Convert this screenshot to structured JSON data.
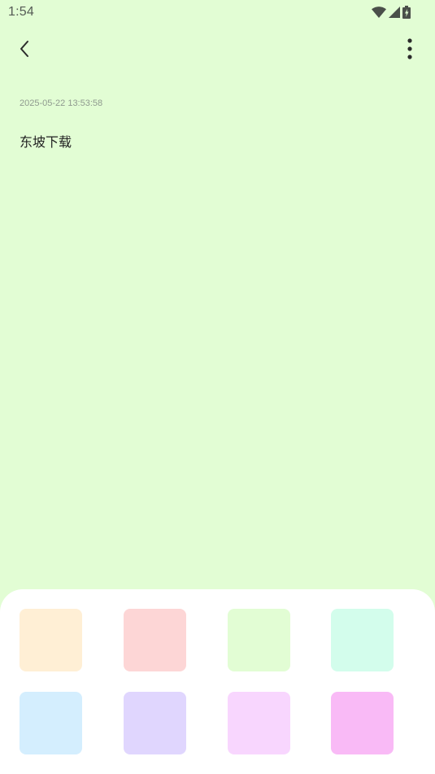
{
  "status_bar": {
    "time": "1:54",
    "icons": [
      "wifi-icon",
      "cellular-signal-icon",
      "battery-charging-icon"
    ]
  },
  "app_bar": {
    "back_icon": "chevron-left-icon",
    "more_icon": "more-vertical-icon"
  },
  "note": {
    "timestamp": "2025-05-22 13:53:58",
    "body": "东坡下载",
    "background_color": "#E2FDD4"
  },
  "color_picker": {
    "swatches": [
      {
        "name": "swatch-peach",
        "color": "#FFEFD5"
      },
      {
        "name": "swatch-pink",
        "color": "#FDD6D6"
      },
      {
        "name": "swatch-light-green",
        "color": "#E2FDD4"
      },
      {
        "name": "swatch-mint",
        "color": "#D3FDEC"
      },
      {
        "name": "swatch-light-blue",
        "color": "#D4EEFE"
      },
      {
        "name": "swatch-lavender",
        "color": "#E0D6FE"
      },
      {
        "name": "swatch-light-pink",
        "color": "#F8D6FE"
      },
      {
        "name": "swatch-magenta-pink",
        "color": "#F9BAF6"
      }
    ]
  }
}
